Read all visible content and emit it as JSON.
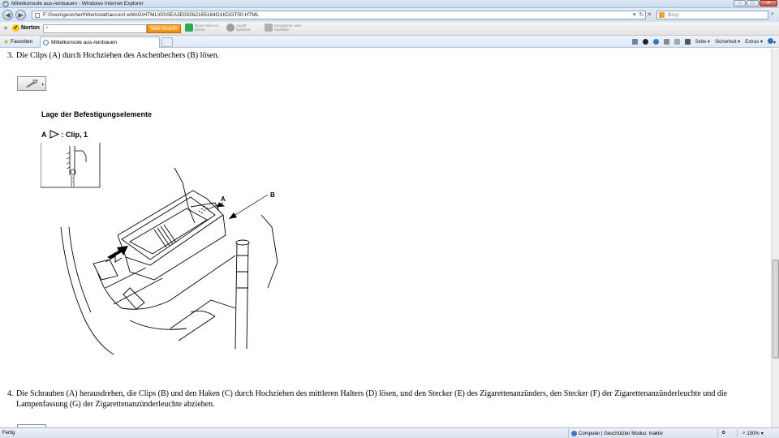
{
  "window": {
    "title": "Mittelkonsole aus-/einbauen - Windows Internet Explorer",
    "minimize": "–",
    "maximize": "□",
    "close": "✕"
  },
  "address_bar": {
    "url": "F:\\Sven\\gesichert\\Werkstatt\\accord whb\\G\\HTML\\00\\SEA3E00262165164O1KDGT00.HTML",
    "search_placeholder": "Bing",
    "back_icon": "arrow-left-icon",
    "forward_icon": "arrow-right-icon"
  },
  "norton_toolbar": {
    "brand": "Norton",
    "search_placeholder": "",
    "safe_search_label": "Safe Search",
    "tool1_line1": "Diese Seite ist",
    "tool1_line2": "Sicher",
    "tool2_line1": "Zugriff",
    "tool2_line2": "Speicher",
    "tool3_line1": "Kennwörter oder",
    "tool3_line2": "Ausfüllen"
  },
  "favorites_bar": {
    "favorites_label": "Favoriten",
    "tab_label": "Mittelkonsole aus-/einbauen"
  },
  "command_bar": {
    "page": "Seite ▾",
    "safety": "Sicherheit ▾",
    "extras": "Extras ▾",
    "help": "▾"
  },
  "content": {
    "step3_num": "3.",
    "step3_text": "Die Clips (A) durch Hochziehen des Aschenbechers (B) lösen.",
    "location_heading": "Lage der Befestigungselemente",
    "legend_letter": "A",
    "legend_text": ": Clip, 1",
    "callout_a": "A",
    "callout_b": "B",
    "step4_num": "4.",
    "step4_text": "Die Schrauben (A) herausdrehen, die Clips (B) und den Haken (C) durch Hochziehen des mittleren Halters (D) lösen, und den Stecker (E) des Zigarettenanzünders, den Stecker (F) der Zigarettenanzünderleuchte und die Lampenfassung (G) der Zigarettenanzünderleuchte abziehen."
  },
  "status_bar": {
    "status": "Fertig",
    "zone": "Computer | Geschützter Modus: Inaktiv",
    "zoom": "150%"
  }
}
